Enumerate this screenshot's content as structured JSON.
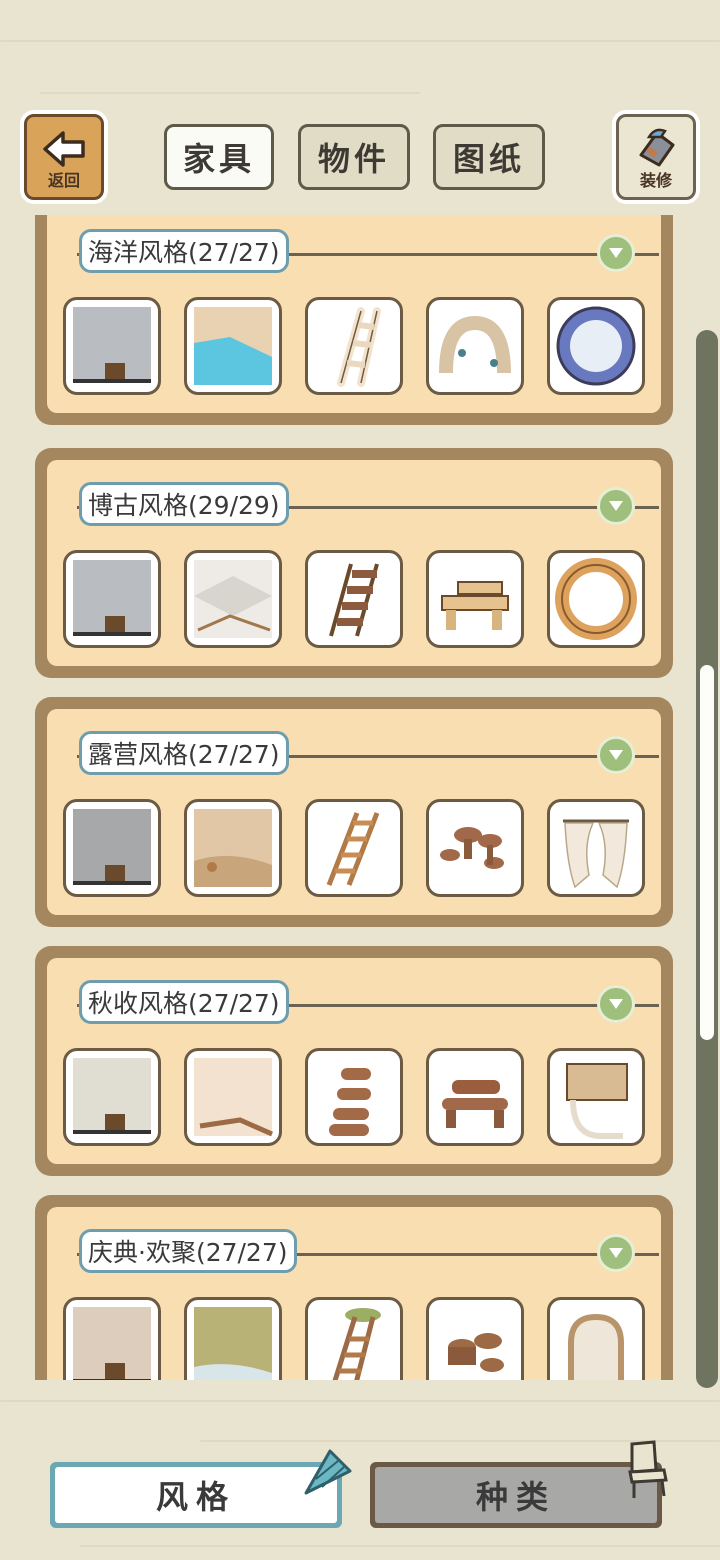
{
  "top": {
    "back_label": "返回",
    "decorate_label": "装修",
    "tabs": [
      {
        "label": "家具",
        "active": true
      },
      {
        "label": "物件",
        "active": false
      },
      {
        "label": "图纸",
        "active": false
      }
    ]
  },
  "sections": [
    {
      "title": "海洋风格(27/27)",
      "items": [
        "wall-shelf-tub-icon",
        "pool-floor-icon",
        "shell-ladder-icon",
        "coral-arch-icon",
        "porthole-window-icon"
      ]
    },
    {
      "title": "博古风格(29/29)",
      "items": [
        "wall-shelf-tub-icon",
        "tile-floor-icon",
        "wood-ladder-icon",
        "log-bench-icon",
        "ring-window-icon"
      ]
    },
    {
      "title": "露营风格(27/27)",
      "items": [
        "wall-shelf-tub-icon",
        "dirt-floor-icon",
        "wood-ladder-icon",
        "mushroom-stools-icon",
        "tent-curtain-icon"
      ]
    },
    {
      "title": "秋收风格(27/27)",
      "items": [
        "wall-shelf-tub-icon",
        "cream-floor-icon",
        "log-ladder-icon",
        "log-bench-icon",
        "scroll-window-icon"
      ]
    },
    {
      "title": "庆典·欢聚(27/27)",
      "items": [
        "wall-shelf-tub-icon",
        "grass-floor-icon",
        "moss-ladder-icon",
        "drum-stools-icon",
        "arch-window-icon"
      ]
    }
  ],
  "bottom": {
    "style_label": "风格",
    "kind_label": "种类",
    "active": "风格"
  },
  "colors": {
    "background": "#e9e4cf",
    "panel_fill": "#f8deb0",
    "panel_border": "#a4875e",
    "title_border": "#6e9eae",
    "toggle_green": "#9fbf7c",
    "scrollbar": "#6f7460"
  }
}
